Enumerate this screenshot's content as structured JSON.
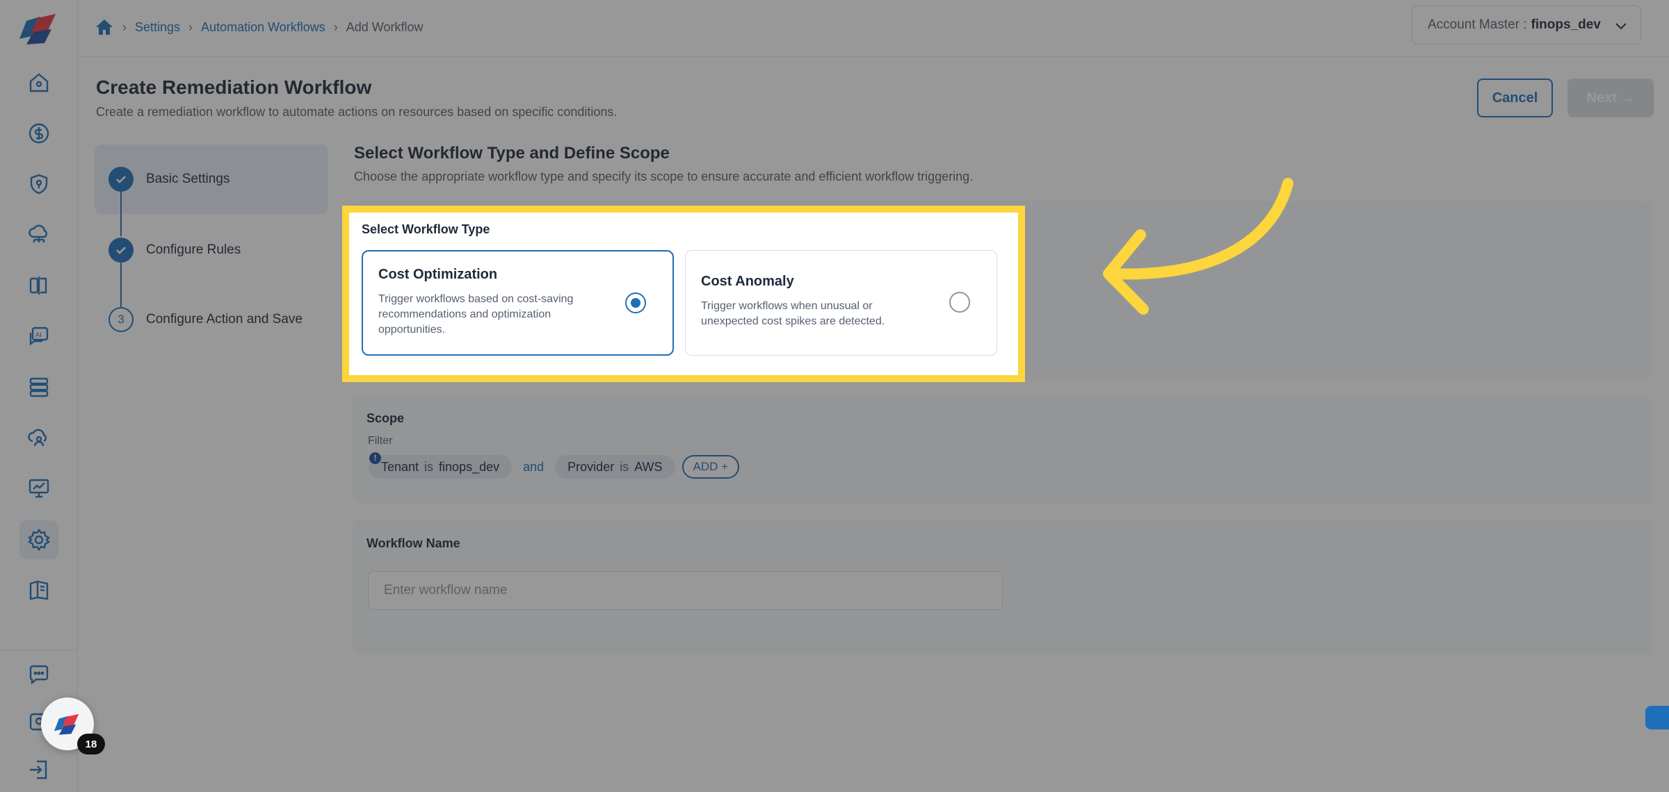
{
  "sidebar": {
    "logo": "app-logo",
    "items": [
      {
        "name": "home-icon"
      },
      {
        "name": "dollar-icon"
      },
      {
        "name": "shield-icon"
      },
      {
        "name": "cloud-network-icon"
      },
      {
        "name": "compare-icon"
      },
      {
        "name": "ai-chat-icon"
      },
      {
        "name": "server-icon"
      },
      {
        "name": "cloud-user-icon"
      },
      {
        "name": "presentation-chart-icon"
      },
      {
        "name": "settings-icon",
        "active": true
      },
      {
        "name": "book-icon"
      },
      {
        "name": "feedback-icon"
      },
      {
        "name": "support-icon"
      },
      {
        "name": "logout-icon"
      }
    ]
  },
  "breadcrumb": {
    "items": [
      "Settings",
      "Automation Workflows"
    ],
    "current": "Add Workflow"
  },
  "account": {
    "label": "Account Master :",
    "value": "finops_dev"
  },
  "header": {
    "title": "Create Remediation Workflow",
    "subtitle": "Create a remediation workflow to automate actions on resources based on specific conditions.",
    "cancel_label": "Cancel",
    "next_label": "Next →"
  },
  "steps": [
    {
      "label": "Basic Settings",
      "status": "done"
    },
    {
      "label": "Configure Rules",
      "status": "done"
    },
    {
      "label": "Configure Action and Save",
      "number": "3",
      "status": "pending"
    }
  ],
  "section": {
    "title": "Select Workflow Type and Define Scope",
    "subtitle": "Choose the appropriate workflow type and specify its scope to ensure accurate and efficient workflow triggering."
  },
  "workflow_type": {
    "label": "Select Workflow Type",
    "options": [
      {
        "title": "Cost Optimization",
        "desc": "Trigger workflows based on cost-saving recommendations and optimization opportunities.",
        "selected": true
      },
      {
        "title": "Cost Anomaly",
        "desc": "Trigger workflows when unusual or unexpected cost spikes are detected.",
        "selected": false
      }
    ]
  },
  "scope": {
    "label": "Scope",
    "filter_label": "Filter",
    "info": "!",
    "filters": [
      {
        "key": "Tenant",
        "op": "is",
        "value": "finops_dev"
      },
      {
        "key": "Provider",
        "op": "is",
        "value": "AWS"
      }
    ],
    "joiner": "and",
    "add_label": "ADD +"
  },
  "workflow_name": {
    "label": "Workflow Name",
    "placeholder": "Enter workflow name",
    "value": ""
  },
  "floating": {
    "badge_count": "18"
  },
  "colors": {
    "primary": "#1f6fb8",
    "highlight": "#fdd53c",
    "active_bg": "#e8f0fa"
  }
}
